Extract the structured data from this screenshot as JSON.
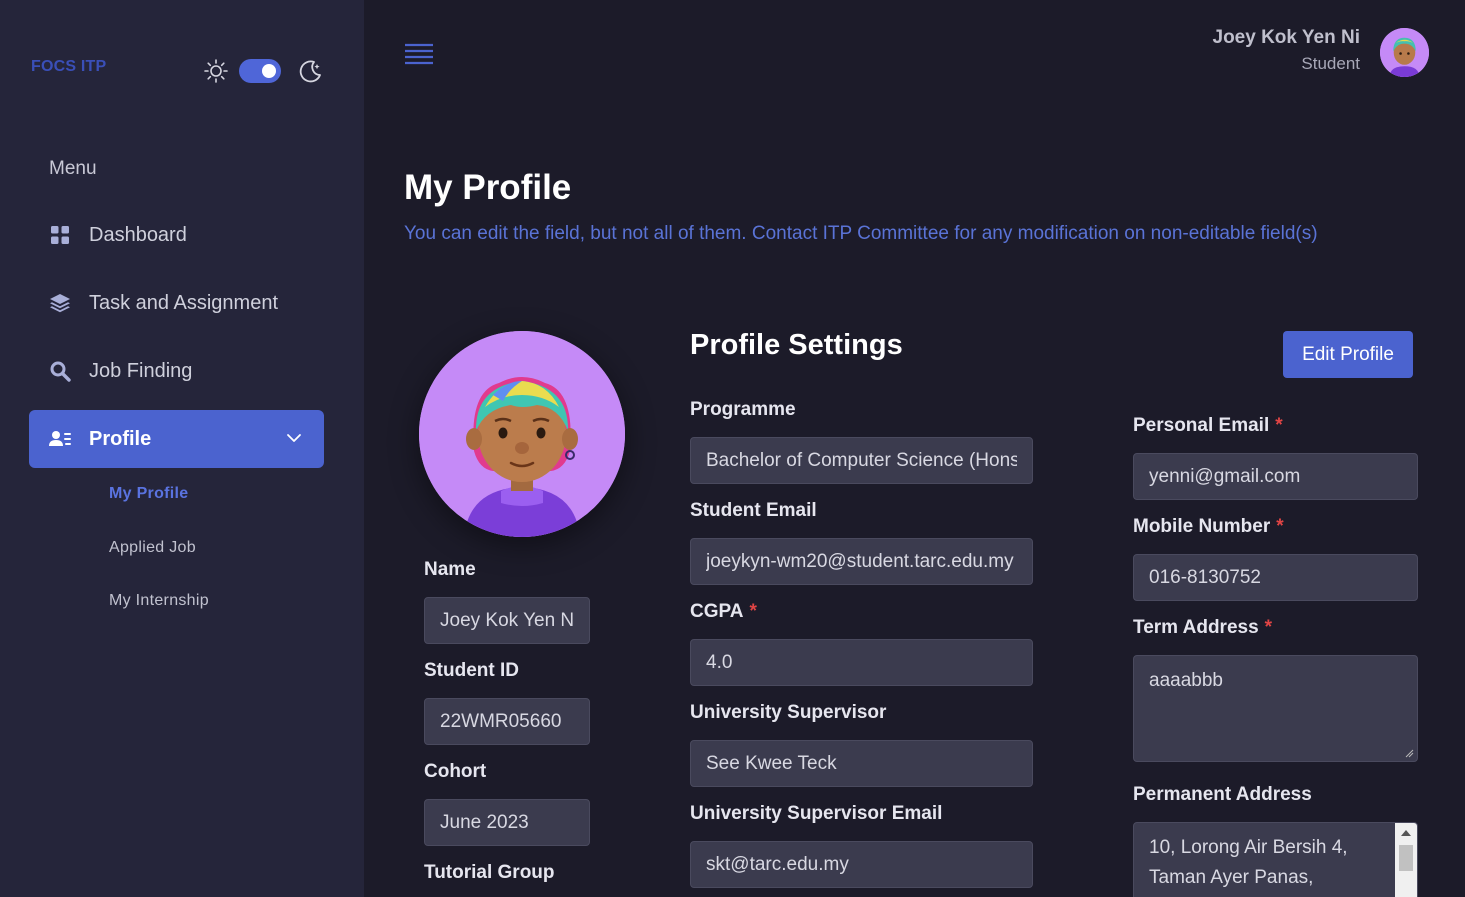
{
  "sidebar": {
    "brand": "FOCS ITP",
    "menu_title": "Menu",
    "items": [
      {
        "label": "Dashboard",
        "icon": "grid-icon"
      },
      {
        "label": "Task and Assignment",
        "icon": "layers-icon"
      },
      {
        "label": "Job Finding",
        "icon": "search-icon"
      },
      {
        "label": "Profile",
        "icon": "user-list-icon",
        "active": true
      }
    ],
    "sub_items": [
      {
        "label": "My Profile",
        "active": true
      },
      {
        "label": "Applied Job"
      },
      {
        "label": "My Internship"
      }
    ],
    "theme_toggle": "dark"
  },
  "header": {
    "user_name": "Joey Kok Yen Ni",
    "user_role": "Student"
  },
  "page": {
    "title": "My Profile",
    "subtitle": "You can edit the field, but not all of them. Contact ITP Committee for any modification on non-editable field(s)"
  },
  "profile": {
    "section_title": "Profile Settings",
    "edit_button": "Edit Profile",
    "required_mark": "*",
    "left": {
      "name_label": "Name",
      "name_value": "Joey Kok Yen Ni",
      "student_id_label": "Student ID",
      "student_id_value": "22WMR05660",
      "cohort_label": "Cohort",
      "cohort_value": "June 2023",
      "tutorial_group_label": "Tutorial Group"
    },
    "middle": {
      "programme_label": "Programme",
      "programme_value": "Bachelor of Computer Science (Hons)",
      "student_email_label": "Student Email",
      "student_email_value": "joeykyn-wm20@student.tarc.edu.my",
      "cgpa_label": "CGPA",
      "cgpa_value": "4.0",
      "supervisor_label": "University Supervisor",
      "supervisor_value": "See Kwee Teck",
      "supervisor_email_label": "University Supervisor Email",
      "supervisor_email_value": "skt@tarc.edu.my"
    },
    "right": {
      "personal_email_label": "Personal Email",
      "personal_email_value": "yenni@gmail.com",
      "mobile_label": "Mobile Number",
      "mobile_value": "016-8130752",
      "term_address_label": "Term Address",
      "term_address_value": "aaaabbb",
      "permanent_address_label": "Permanent Address",
      "permanent_address_line1": "10, Lorong Air Bersih 4,",
      "permanent_address_line2": "Taman Ayer Panas,"
    }
  },
  "colors": {
    "background": "#1c1b29",
    "sidebar": "#25253a",
    "accent": "#4b63cf",
    "required": "#e24545",
    "avatar_bg": "#c58af7"
  }
}
